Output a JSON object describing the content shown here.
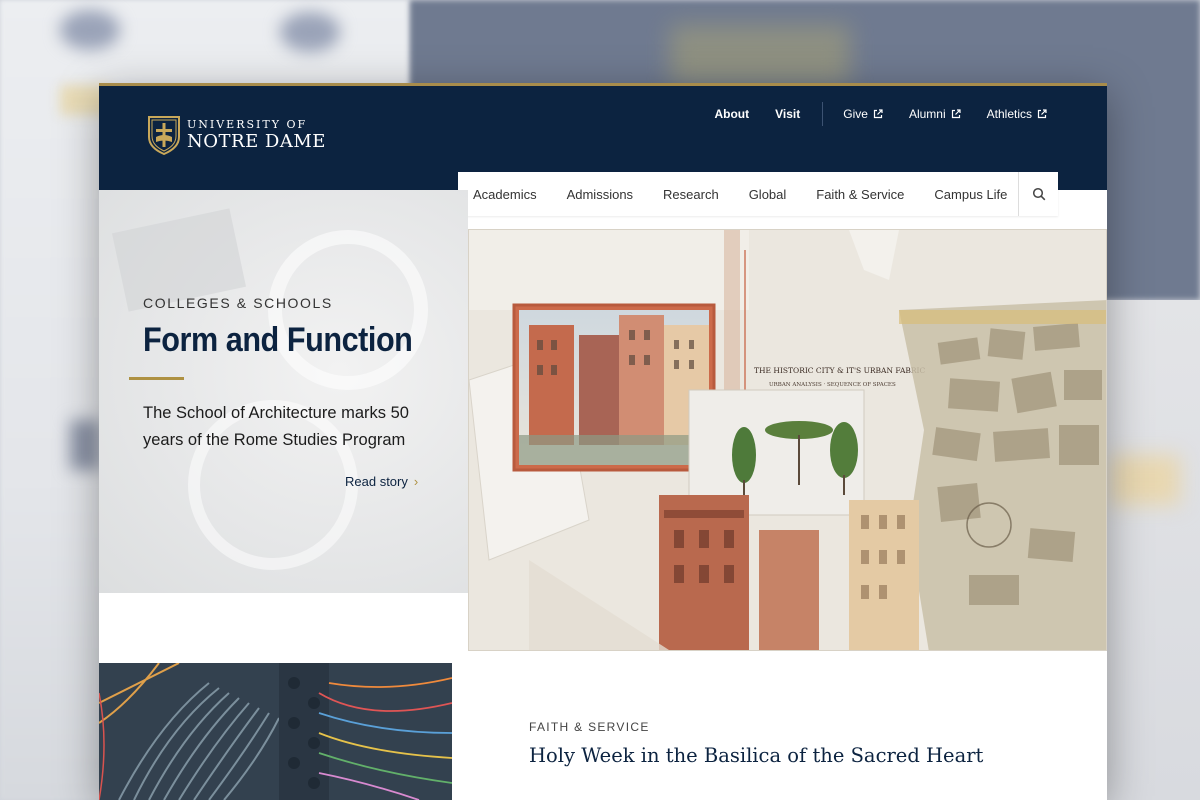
{
  "logo": {
    "line1": "UNIVERSITY OF",
    "line2": "NOTRE DAME"
  },
  "utility_nav": {
    "about": "About",
    "visit": "Visit",
    "give": "Give",
    "alumni": "Alumni",
    "athletics": "Athletics"
  },
  "main_nav": {
    "items": [
      "Academics",
      "Admissions",
      "Research",
      "Global",
      "Faith & Service",
      "Campus Life"
    ]
  },
  "hero": {
    "eyebrow": "COLLEGES & SCHOOLS",
    "title": "Form and Function",
    "description": "The School of Architecture marks 50 years of the Rome Studies Program",
    "cta": "Read story",
    "image_caption_line1": "THE HISTORIC CITY & IT'S URBAN FABRIC",
    "image_caption_line2": "URBAN ANALYSIS · SEQUENCE OF SPACES"
  },
  "second_story": {
    "eyebrow": "FAITH & SERVICE",
    "title": "Holy Week in the Basilica of the Sacred Heart"
  },
  "colors": {
    "navy": "#0c2340",
    "gold": "#ae9142"
  },
  "icons": {
    "external": "external-link-icon",
    "search": "search-icon",
    "chevron": "chevron-right-icon"
  }
}
